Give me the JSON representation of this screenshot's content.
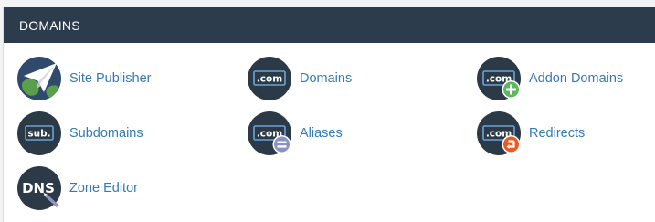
{
  "panel": {
    "title": "DOMAINS",
    "colors": {
      "header_bg": "#2d3c4d",
      "link": "#337ab7",
      "icon_bg": "#2c3a48",
      "add_badge": "#5cb85c",
      "alias_badge": "#8a92c4",
      "redirect_badge": "#ea5a22"
    }
  },
  "items": [
    {
      "label": "Site Publisher",
      "icon": "paper-plane-globe-icon"
    },
    {
      "label": "Domains",
      "icon": "dot-com-icon",
      "icon_text": ".com"
    },
    {
      "label": "Addon Domains",
      "icon": "dot-com-add-icon",
      "icon_text": ".com"
    },
    {
      "label": "Subdomains",
      "icon": "sub-domain-icon",
      "icon_text": "sub."
    },
    {
      "label": "Aliases",
      "icon": "dot-com-alias-icon",
      "icon_text": ".com"
    },
    {
      "label": "Redirects",
      "icon": "dot-com-redirect-icon",
      "icon_text": ".com"
    },
    {
      "label": "Zone Editor",
      "icon": "dns-zone-editor-icon",
      "icon_text": "DNS"
    }
  ]
}
